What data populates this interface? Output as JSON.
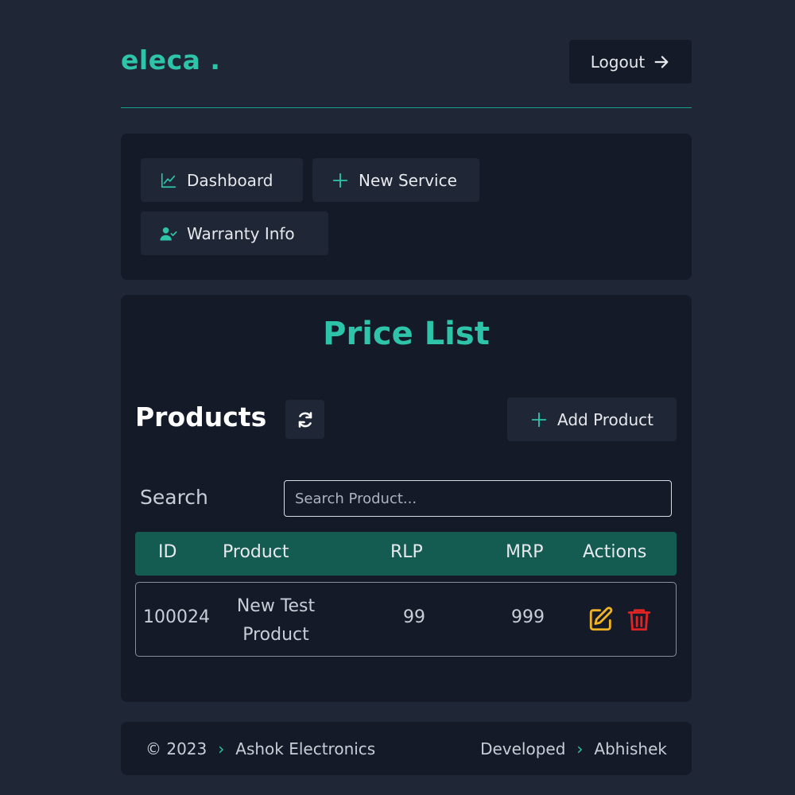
{
  "brand": {
    "logo": "eleca ."
  },
  "header": {
    "logout_label": "Logout"
  },
  "nav": {
    "items": [
      {
        "label": "Dashboard",
        "icon": "chart-line-icon"
      },
      {
        "label": "New Service",
        "icon": "plus-icon"
      },
      {
        "label": "Warranty Info",
        "icon": "user-check-icon"
      }
    ]
  },
  "price_list": {
    "title": "Price List",
    "products_heading": "Products",
    "add_product_label": "Add Product",
    "search_label": "Search",
    "search_placeholder": "Search Product...",
    "columns": [
      "ID",
      "Product",
      "RLP",
      "MRP",
      "Actions"
    ],
    "rows": [
      {
        "id": "100024",
        "product_line1": "New Test",
        "product_line2": "Product",
        "rlp": "99",
        "mrp": "999"
      }
    ]
  },
  "footer": {
    "copyright": "© 2023",
    "company": "Ashok Electronics",
    "developed_label": "Developed",
    "developer": "Abhishek"
  },
  "colors": {
    "accent": "#2ec4a9",
    "background": "#1f2636",
    "card": "#141a28",
    "table_header": "#145c52",
    "edit": "#f0b323",
    "delete": "#e02424"
  }
}
